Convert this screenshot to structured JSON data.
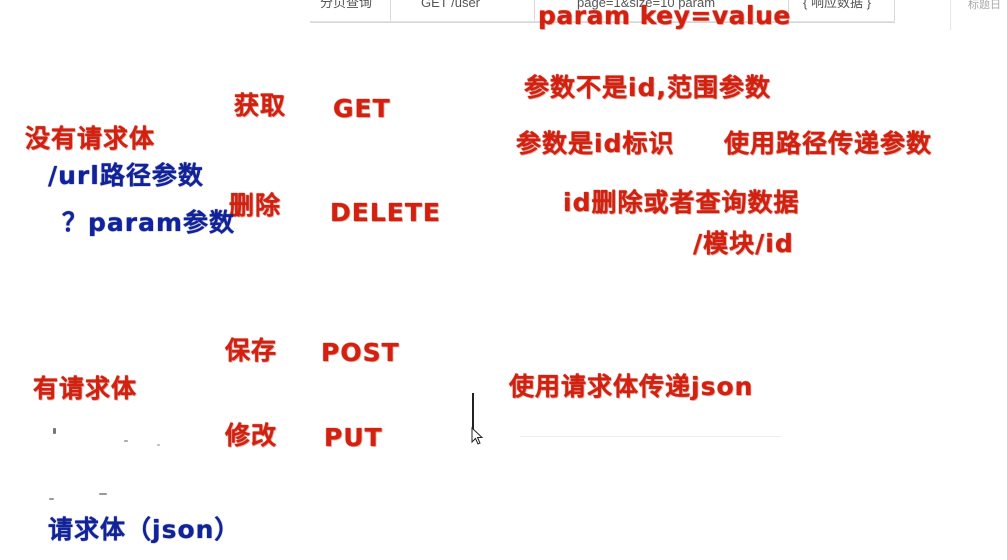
{
  "table": {
    "col1": "分页查询",
    "col2": "GET  /user",
    "col3": "page=1&size=10 param",
    "col4": "{ 响应数据 }"
  },
  "top_right_text": "标题日",
  "labels": {
    "param_kv": "param  key=value",
    "get_cn": "获取",
    "get_en": "GET",
    "delete_cn": "删除",
    "delete_en": "DELETE",
    "post_cn": "保存",
    "post_en": "POST",
    "put_cn": "修改",
    "put_en": "PUT",
    "no_body": "没有请求体",
    "url_path": "/url路径参数",
    "query_param": "？param参数",
    "range_param": "参数不是id,范围参数",
    "id_param": "参数是id标识",
    "path_pass": "使用路径传递参数",
    "id_delete": "id删除或者查询数据",
    "module_id": "/模块/id",
    "has_body": "有请求体",
    "body_json_pass": "使用请求体传递json",
    "body_json": "请求体（json）"
  },
  "colors": {
    "red": "#d6200f",
    "blue": "#10239c"
  }
}
